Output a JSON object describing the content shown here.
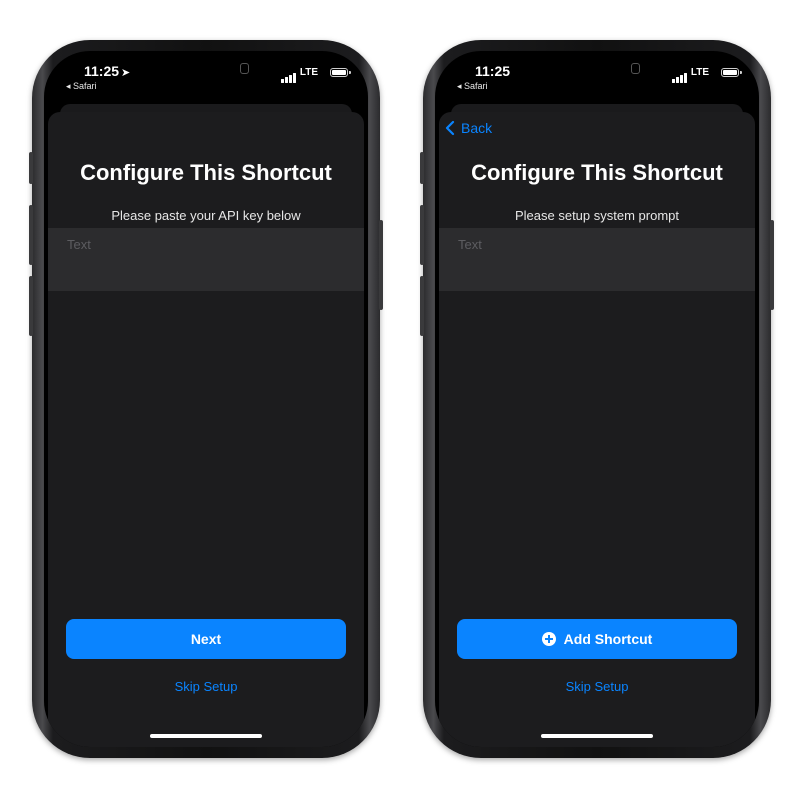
{
  "colors": {
    "accent": "#0a84ff",
    "sheet": "#1c1c1e",
    "field": "#2c2c2e"
  },
  "left_phone": {
    "status": {
      "time": "11:25",
      "back_app": "◂ Safari",
      "network": "LTE"
    },
    "title": "Configure This Shortcut",
    "subtitle": "Please paste your API key below",
    "input_placeholder": "Text",
    "primary_button": "Next",
    "skip_link": "Skip Setup"
  },
  "right_phone": {
    "status": {
      "time": "11:25",
      "back_app": "◂ Safari",
      "network": "LTE"
    },
    "back_label": "Back",
    "title": "Configure This Shortcut",
    "subtitle": "Please setup system prompt",
    "input_placeholder": "Text",
    "primary_button": "Add Shortcut",
    "primary_button_icon": "plus-circle-icon",
    "skip_link": "Skip Setup"
  }
}
